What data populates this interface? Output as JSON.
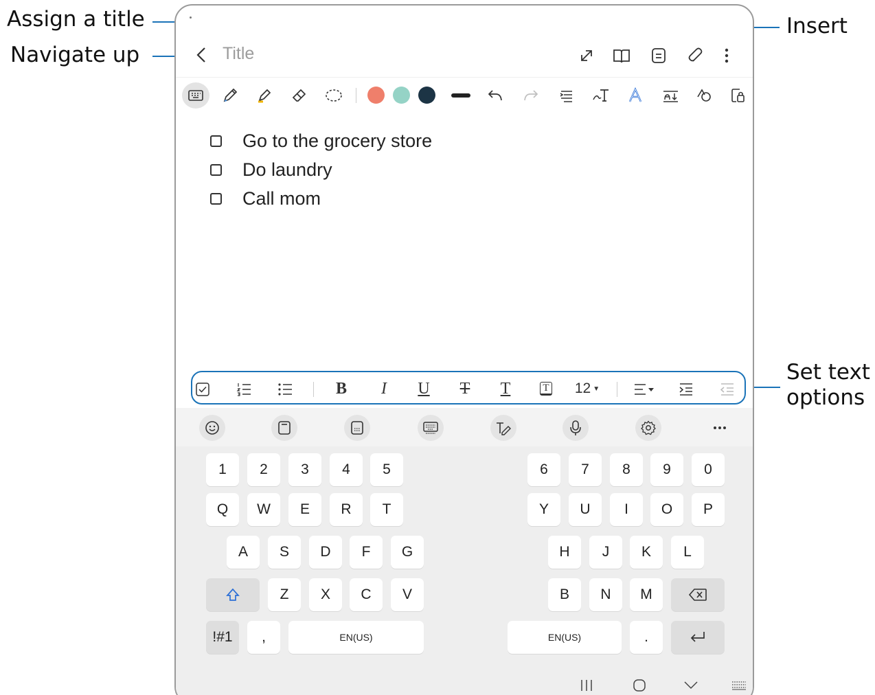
{
  "callouts": {
    "assign_title": "Assign a title",
    "navigate_up": "Navigate up",
    "insert": "Insert",
    "set_text_line1": "Set text",
    "set_text_line2": "options"
  },
  "note": {
    "title_placeholder": "Title",
    "checklist": [
      "Go to the grocery store",
      "Do laundry",
      "Call mom"
    ]
  },
  "pen_colors": [
    "#ef7f6b",
    "#95d3c6",
    "#1c3445"
  ],
  "header_icons": [
    "back-icon",
    "expand-icon",
    "book-icon",
    "page-icon",
    "attach-icon",
    "more-vertical-icon"
  ],
  "text_options": {
    "bold": "B",
    "italic": "I",
    "underline": "U",
    "strikethrough": "T",
    "text_color": "T",
    "highlight": "T",
    "font_size": "12"
  },
  "keyboard": {
    "number_row_left": [
      "1",
      "2",
      "3",
      "4",
      "5"
    ],
    "number_row_right": [
      "6",
      "7",
      "8",
      "9",
      "0"
    ],
    "row1_left": [
      "Q",
      "W",
      "E",
      "R",
      "T"
    ],
    "row1_right": [
      "Y",
      "U",
      "I",
      "O",
      "P"
    ],
    "row2_left": [
      "A",
      "S",
      "D",
      "F",
      "G"
    ],
    "row2_right": [
      "H",
      "J",
      "K",
      "L"
    ],
    "row3_left": [
      "Z",
      "X",
      "C",
      "V"
    ],
    "row3_right": [
      "B",
      "N",
      "M"
    ],
    "symbols": "!#1",
    "comma": ",",
    "space_left": "EN(US)",
    "space_right": "EN(US)",
    "period": "."
  }
}
